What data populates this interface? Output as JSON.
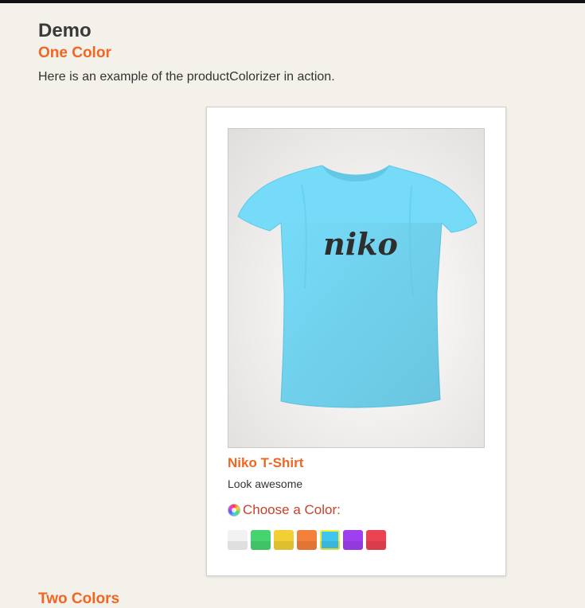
{
  "page": {
    "title": "Demo",
    "section_one": "One Color",
    "intro": "Here is an example of the productColorizer in action.",
    "section_two": "Two Colors"
  },
  "product": {
    "image_icon": "tshirt-icon",
    "shirt_text": "niko",
    "shirt_color": "#76dbf8",
    "name": "Niko T-Shirt",
    "description": "Look awesome",
    "choose_label": "Choose a Color:",
    "choose_icon": "color-wheel-icon"
  },
  "swatches": [
    {
      "name": "white",
      "color": "#f2f2f2",
      "selected": false
    },
    {
      "name": "green",
      "color": "#45d46f",
      "selected": false
    },
    {
      "name": "yellow",
      "color": "#f2cf34",
      "selected": false
    },
    {
      "name": "orange",
      "color": "#f58039",
      "selected": false
    },
    {
      "name": "blue",
      "color": "#3fc5ee",
      "selected": true
    },
    {
      "name": "purple",
      "color": "#a03ff0",
      "selected": false
    },
    {
      "name": "red",
      "color": "#ec4353",
      "selected": false
    }
  ],
  "colors": {
    "accent": "#f26522",
    "choose_label": "#c8412a",
    "background": "#f3f1ea"
  }
}
